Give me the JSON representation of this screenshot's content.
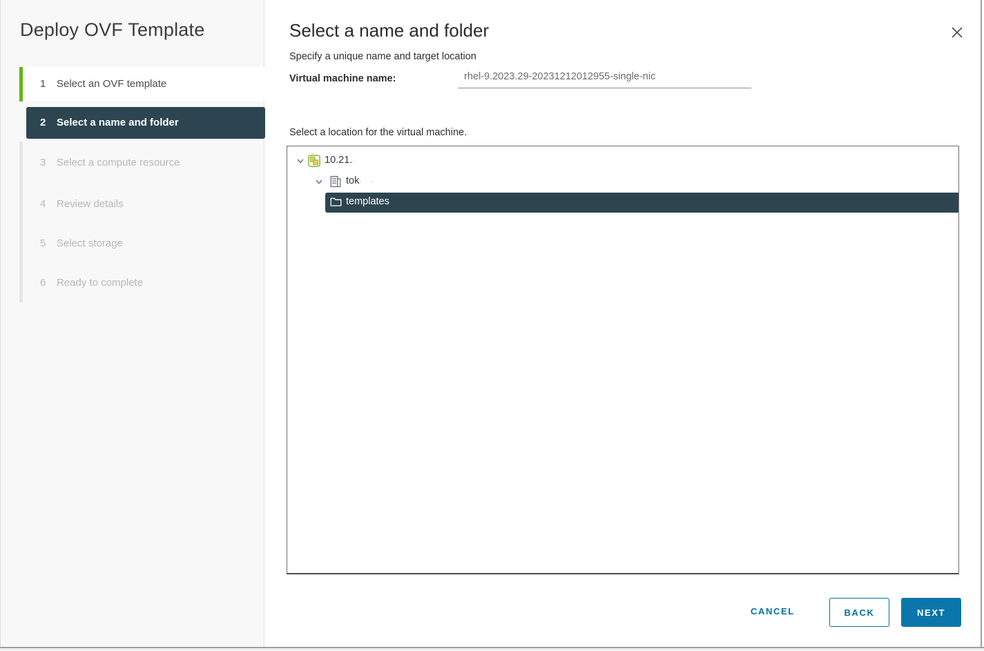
{
  "dialog": {
    "title": "Deploy OVF Template"
  },
  "steps": [
    {
      "number": "1",
      "label": "Select an OVF template",
      "state": "completed"
    },
    {
      "number": "2",
      "label": "Select a name and folder",
      "state": "current"
    },
    {
      "number": "3",
      "label": "Select a compute resource",
      "state": "upcoming"
    },
    {
      "number": "4",
      "label": "Review details",
      "state": "upcoming"
    },
    {
      "number": "5",
      "label": "Select storage",
      "state": "upcoming"
    },
    {
      "number": "6",
      "label": "Ready to complete",
      "state": "upcoming"
    }
  ],
  "main": {
    "heading": "Select a name and folder",
    "subheading": "Specify a unique name and target location",
    "vm_name_label": "Virtual machine name:",
    "vm_name_value": "rhel-9.2023.29-20231212012955-single-nic",
    "location_label": "Select a location for the virtual machine.",
    "tree": [
      {
        "label": "10.21.",
        "redacted_suffix": "·",
        "icon": "vcenter-server-icon",
        "level": 0,
        "expanded": true,
        "selected": false
      },
      {
        "label": "tok",
        "redacted_suffix": "- -",
        "icon": "datacenter-icon",
        "level": 1,
        "expanded": true,
        "selected": false
      },
      {
        "label": "templates",
        "redacted_suffix": "",
        "icon": "folder-icon",
        "level": 2,
        "expanded": false,
        "selected": true
      }
    ]
  },
  "footer": {
    "cancel_label": "CANCEL",
    "back_label": "BACK",
    "next_label": "NEXT"
  },
  "colors": {
    "accent_green": "#61b715",
    "active_step_bg": "#2d4550",
    "action_blue": "#0072a3",
    "sidebar_bg": "#f8f8f8"
  }
}
